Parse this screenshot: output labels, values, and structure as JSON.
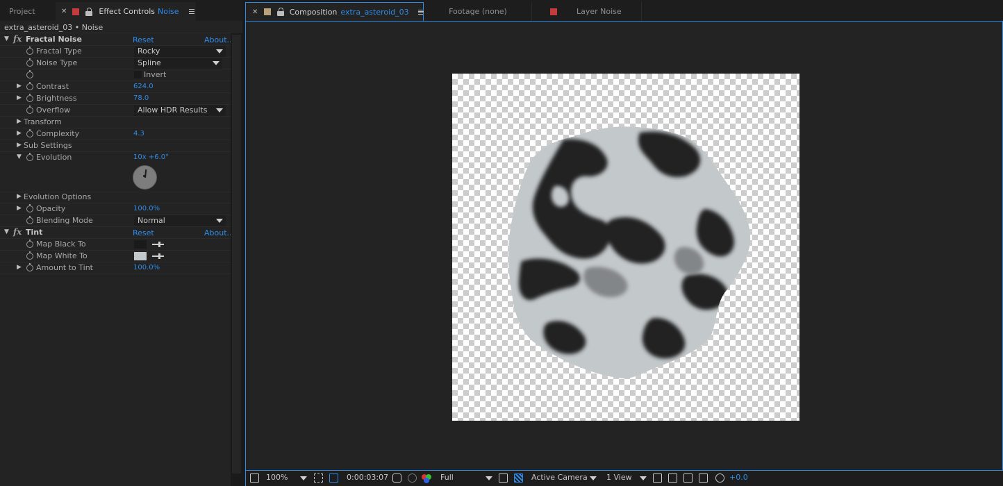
{
  "left_tabs": {
    "project": "Project",
    "effect_controls": "Effect Controls",
    "effect_controls_layer": "Noise"
  },
  "effect_controls": {
    "header": "extra_asteroid_03 • Noise",
    "reset": "Reset",
    "about": "About...",
    "fractal_noise": {
      "name": "Fractal Noise",
      "fractal_type_label": "Fractal Type",
      "fractal_type_value": "Rocky",
      "noise_type_label": "Noise Type",
      "noise_type_value": "Spline",
      "invert_label": "Invert",
      "contrast_label": "Contrast",
      "contrast_value": "624.0",
      "brightness_label": "Brightness",
      "brightness_value": "78.0",
      "overflow_label": "Overflow",
      "overflow_value": "Allow HDR Results",
      "transform_label": "Transform",
      "complexity_label": "Complexity",
      "complexity_value": "4.3",
      "sub_settings_label": "Sub Settings",
      "evolution_label": "Evolution",
      "evolution_value": "10x +6.0°",
      "evolution_options_label": "Evolution Options",
      "opacity_label": "Opacity",
      "opacity_value": "100.0%",
      "blending_mode_label": "Blending Mode",
      "blending_mode_value": "Normal"
    },
    "tint": {
      "name": "Tint",
      "map_black_label": "Map Black To",
      "map_black_color": "#1a1a1a",
      "map_white_label": "Map White To",
      "map_white_color": "#c3c8cb",
      "amount_label": "Amount to Tint",
      "amount_value": "100.0%"
    }
  },
  "right_tabs": {
    "composition_label": "Composition",
    "composition_name": "extra_asteroid_03",
    "footage": "Footage (none)",
    "layer": "Layer Noise"
  },
  "viewer_footer": {
    "zoom": "100%",
    "timecode": "0:00:03:07",
    "resolution": "Full",
    "camera": "Active Camera",
    "view": "1 View",
    "exposure": "+0.0"
  },
  "colors": {
    "accent": "#2d8ceb",
    "panel_bg": "#232323",
    "label_red": "#c33b3b",
    "label_tan": "#b9a27c",
    "asteroid_light": "#c3c8cb",
    "asteroid_dark": "#1f1f1f"
  }
}
